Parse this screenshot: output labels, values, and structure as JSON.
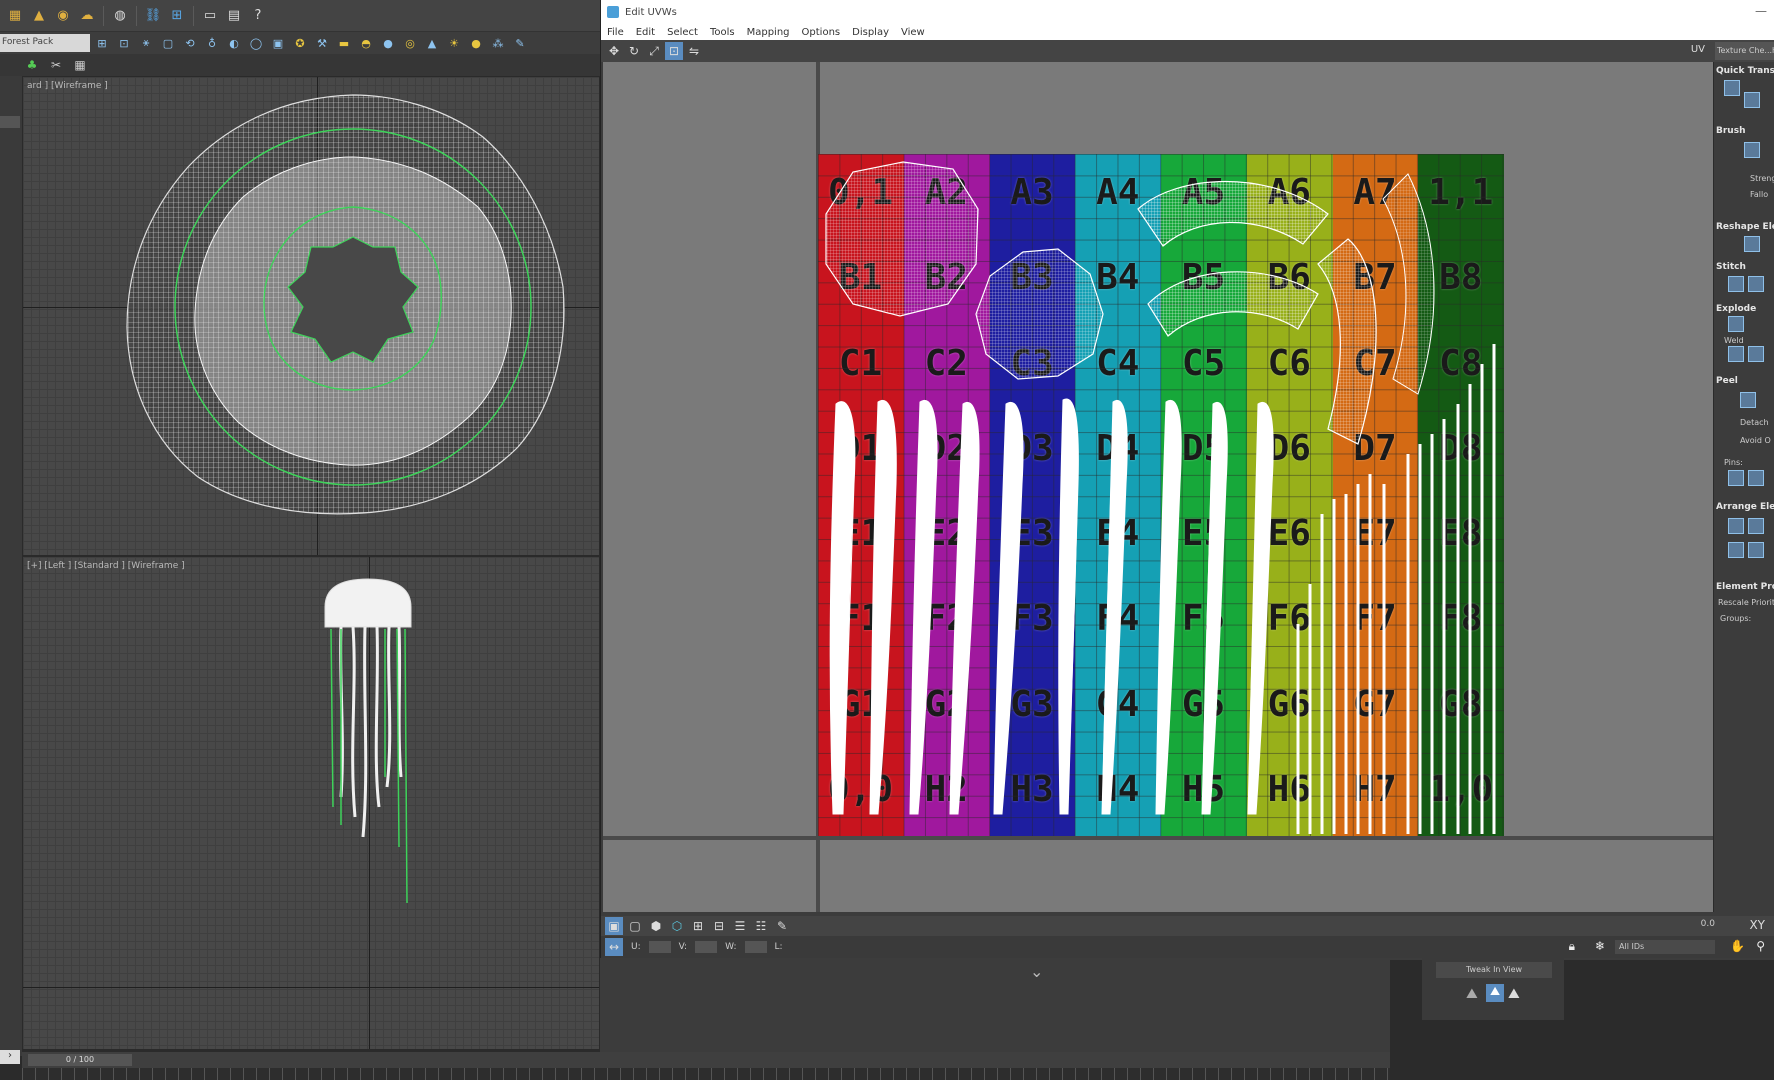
{
  "main_toolbar": {
    "help_icon": "question-icon"
  },
  "forest_pack": {
    "label": "Forest Pack"
  },
  "viewports": {
    "top": {
      "label": "ard ] [Wireframe ]"
    },
    "left": {
      "label": "[+] [Left ] [Standard ] [Wireframe ]"
    }
  },
  "uvw_window": {
    "title": "Edit UVWs",
    "menu": [
      "File",
      "Edit",
      "Select",
      "Tools",
      "Mapping",
      "Options",
      "Display",
      "View"
    ],
    "uv_tab": "UV",
    "texture_checker": "Texture Che...h",
    "bottom": {
      "u_label": "U:",
      "v_label": "V:",
      "w_label": "W:",
      "l_label": "L:",
      "zero": "0.0",
      "xy": "XY",
      "all_ids": "All IDs"
    }
  },
  "checker": {
    "rows": [
      [
        "0,1",
        "A2",
        "A3",
        "A4",
        "A5",
        "A6",
        "A7",
        "1,1"
      ],
      [
        "B1",
        "B2",
        "B3",
        "B4",
        "B5",
        "B6",
        "B7",
        "B8"
      ],
      [
        "C1",
        "C2",
        "C3",
        "C4",
        "C5",
        "C6",
        "C7",
        "C8"
      ],
      [
        "D1",
        "D2",
        "D3",
        "D4",
        "D5",
        "D6",
        "D7",
        "D8"
      ],
      [
        "E1",
        "E2",
        "E3",
        "E4",
        "E5",
        "E6",
        "E7",
        "E8"
      ],
      [
        "F1",
        "F2",
        "F3",
        "F4",
        "F5",
        "F6",
        "F7",
        "F8"
      ],
      [
        "G1",
        "G2",
        "G3",
        "G4",
        "G5",
        "G6",
        "G7",
        "G8"
      ],
      [
        "0,0",
        "H2",
        "H3",
        "H4",
        "H5",
        "H6",
        "H7",
        "1,0"
      ]
    ],
    "colors": [
      "#c8141e",
      "#a0189e",
      "#1e1ea0",
      "#15a0b4",
      "#17a83a",
      "#98b01a",
      "#d46a14",
      "#145a14"
    ]
  },
  "right_panel": {
    "quick_transform": "Quick Transf",
    "brush": "Brush",
    "strength": "Streng",
    "falloff": "Fallo",
    "reshape": "Reshape Ele",
    "stitch": "Stitch",
    "explode": "Explode",
    "weld": "Weld",
    "peel": "Peel",
    "detach": "Detach",
    "avoid": "Avoid O",
    "pins": "Pins:",
    "arrange": "Arrange Ele",
    "element_props": "Element Pro",
    "rescale": "Rescale Priority",
    "groups": "Groups:"
  },
  "tweak": {
    "button": "Tweak In View"
  },
  "timeline": {
    "slider": "0 / 100"
  }
}
